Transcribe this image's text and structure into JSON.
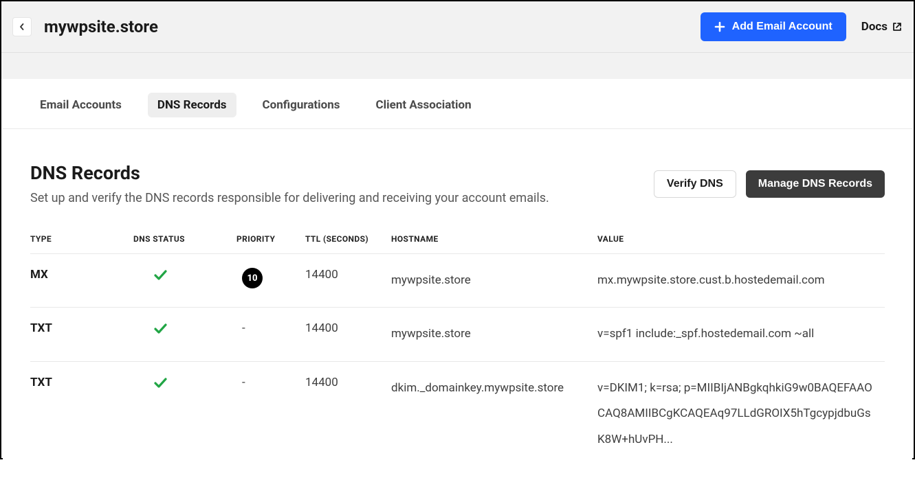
{
  "header": {
    "site_title": "mywpsite.store",
    "add_email_label": "Add Email Account",
    "docs_label": "Docs"
  },
  "tabs": [
    {
      "label": "Email Accounts",
      "active": false
    },
    {
      "label": "DNS Records",
      "active": true
    },
    {
      "label": "Configurations",
      "active": false
    },
    {
      "label": "Client Association",
      "active": false
    }
  ],
  "section": {
    "title": "DNS Records",
    "description": "Set up and verify the DNS records responsible for delivering and receiving your account emails.",
    "verify_label": "Verify DNS",
    "manage_label": "Manage DNS Records"
  },
  "table": {
    "columns": {
      "type": "TYPE",
      "status": "DNS STATUS",
      "priority": "PRIORITY",
      "ttl": "TTL (SECONDS)",
      "hostname": "HOSTNAME",
      "value": "VALUE"
    },
    "rows": [
      {
        "type": "MX",
        "status": "verified",
        "priority": "10",
        "ttl": "14400",
        "hostname": "mywpsite.store",
        "value": "mx.mywpsite.store.cust.b.hostedemail.com"
      },
      {
        "type": "TXT",
        "status": "verified",
        "priority": "-",
        "ttl": "14400",
        "hostname": "mywpsite.store",
        "value": "v=spf1 include:_spf.hostedemail.com ~all"
      },
      {
        "type": "TXT",
        "status": "verified",
        "priority": "-",
        "ttl": "14400",
        "hostname": "dkim._domainkey.mywpsite.store",
        "value": "v=DKIM1; k=rsa; p=MIIBIjANBgkqhkiG9w0BAQEFAAOCAQ8AMIIBCgKCAQEAq97LLdGROIX5hTgcypjdbuGsK8W+hUvPH..."
      }
    ]
  }
}
